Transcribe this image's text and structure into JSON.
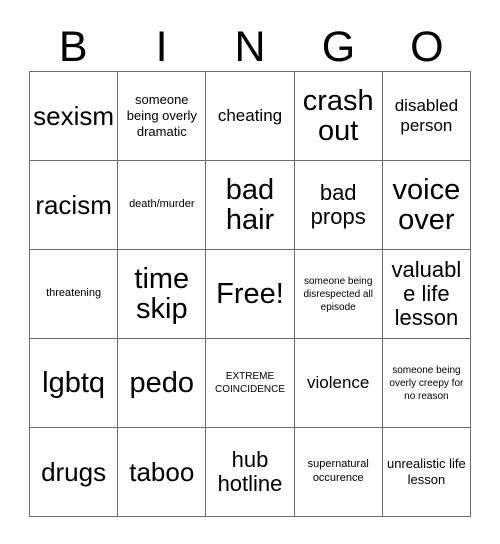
{
  "card": {
    "title_letters": [
      "B",
      "I",
      "N",
      "G",
      "O"
    ],
    "columns": 5,
    "rows": 5,
    "grid_color": "#6b6b6b",
    "text_color": "#000000",
    "background_color": "#ffffff",
    "free_space_label": "Free!",
    "free_space_position": "row3-col3"
  },
  "cells": [
    {
      "id": "r1c1",
      "text": "sexism",
      "size": "xl"
    },
    {
      "id": "r1c2",
      "text": "someone being overly dramatic",
      "size": "s"
    },
    {
      "id": "r1c3",
      "text": "cheating",
      "size": "m"
    },
    {
      "id": "r1c4",
      "text": "crash out",
      "size": "xxl"
    },
    {
      "id": "r1c5",
      "text": "disabled person",
      "size": "m"
    },
    {
      "id": "r2c1",
      "text": "racism",
      "size": "xl"
    },
    {
      "id": "r2c2",
      "text": "death/murder",
      "size": "xs"
    },
    {
      "id": "r2c3",
      "text": "bad hair",
      "size": "xxl"
    },
    {
      "id": "r2c4",
      "text": "bad props",
      "size": "l"
    },
    {
      "id": "r2c5",
      "text": "voice over",
      "size": "xxl"
    },
    {
      "id": "r3c1",
      "text": "threatening",
      "size": "xs"
    },
    {
      "id": "r3c2",
      "text": "time skip",
      "size": "xxl"
    },
    {
      "id": "r3c3",
      "text": "Free!",
      "size": "xxl"
    },
    {
      "id": "r3c4",
      "text": "someone being disrespected all episode",
      "size": "xxs"
    },
    {
      "id": "r3c5",
      "text": "valuable life lesson",
      "size": "l"
    },
    {
      "id": "r4c1",
      "text": "lgbtq",
      "size": "xxl"
    },
    {
      "id": "r4c2",
      "text": "pedo",
      "size": "xxl"
    },
    {
      "id": "r4c3",
      "text": "EXTREME COINCIDENCE",
      "size": "xxs"
    },
    {
      "id": "r4c4",
      "text": "violence",
      "size": "m"
    },
    {
      "id": "r4c5",
      "text": "someone being overly creepy for no reason",
      "size": "xxs"
    },
    {
      "id": "r5c1",
      "text": "drugs",
      "size": "xl"
    },
    {
      "id": "r5c2",
      "text": "taboo",
      "size": "xl"
    },
    {
      "id": "r5c3",
      "text": "hub hotline",
      "size": "l"
    },
    {
      "id": "r5c4",
      "text": "supernatural occurence",
      "size": "xs"
    },
    {
      "id": "r5c5",
      "text": "unrealistic life lesson",
      "size": "s"
    }
  ]
}
